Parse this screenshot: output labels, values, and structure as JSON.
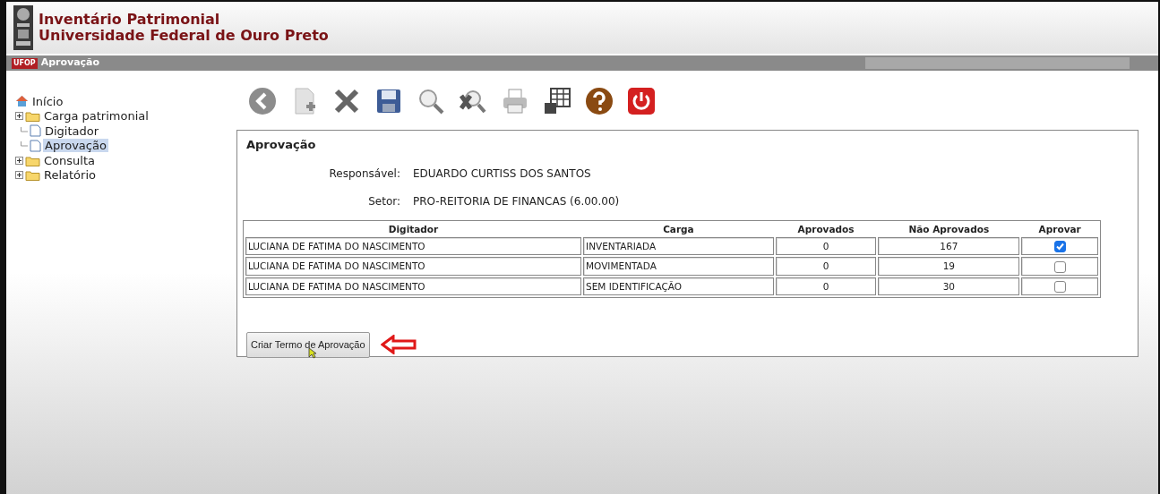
{
  "header": {
    "title": "Inventário Patrimonial",
    "subtitle": "Universidade Federal de Ouro Preto"
  },
  "nav_bar": {
    "badge": "UFOP",
    "page": "Aprovação"
  },
  "sidebar": {
    "items": [
      {
        "label": "Início",
        "kind": "home",
        "selected": false
      },
      {
        "label": "Carga patrimonial",
        "kind": "folder",
        "expanded": false,
        "selected": false
      },
      {
        "label": "Digitador",
        "kind": "page",
        "selected": false
      },
      {
        "label": "Aprovação",
        "kind": "page",
        "selected": true
      },
      {
        "label": "Consulta",
        "kind": "folder",
        "expanded": false,
        "selected": false
      },
      {
        "label": "Relatório",
        "kind": "folder",
        "expanded": false,
        "selected": false
      }
    ]
  },
  "panel": {
    "title": "Aprovação",
    "fields": [
      {
        "label": "Responsável:",
        "value": "EDUARDO CURTISS DOS SANTOS"
      },
      {
        "label": "Setor:",
        "value": "PRO-REITORIA DE FINANCAS (6.00.00)"
      }
    ],
    "table": {
      "columns": [
        "Digitador",
        "Carga",
        "Aprovados",
        "Não Aprovados",
        "Aprovar"
      ],
      "rows": [
        {
          "digitador": "LUCIANA DE FATIMA DO NASCIMENTO",
          "carga": "INVENTARIADA",
          "aprovados": "0",
          "nao_aprovados": "167",
          "checked": true
        },
        {
          "digitador": "LUCIANA DE FATIMA DO NASCIMENTO",
          "carga": "MOVIMENTADA",
          "aprovados": "0",
          "nao_aprovados": "19",
          "checked": false
        },
        {
          "digitador": "LUCIANA DE FATIMA DO NASCIMENTO",
          "carga": "SEM IDENTIFICAÇÃO",
          "aprovados": "0",
          "nao_aprovados": "30",
          "checked": false
        }
      ]
    },
    "button": "Criar Termo de Aprovação"
  }
}
